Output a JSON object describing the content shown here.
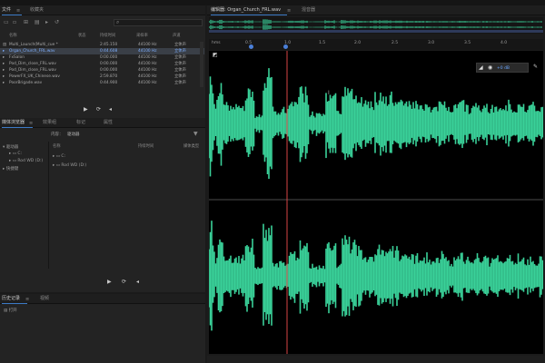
{
  "files_panel": {
    "tabs": [
      "文件",
      "收藏夹"
    ],
    "columns": [
      "名称",
      "状态",
      "持续时间",
      "采样率",
      "声道"
    ],
    "rows": [
      {
        "name": "Multi_Launch(Multi_cue *",
        "dur": "2:45.150",
        "rate": "44100 Hz",
        "ch": "立体声",
        "selected": false
      },
      {
        "name": "Organ_Church_FRL.wav",
        "dur": "0:44.608",
        "rate": "44100 Hz",
        "ch": "立体声",
        "selected": true
      },
      {
        "name": "FxSalon",
        "dur": "0:00.000",
        "rate": "44100 Hz",
        "ch": "立体声",
        "selected": false
      },
      {
        "name": "Pod_Dim_close_FRL.wav",
        "dur": "0:00.000",
        "rate": "44100 Hz",
        "ch": "立体声",
        "selected": false
      },
      {
        "name": "Pod_Dim_close_FRL.wav",
        "dur": "0:00.000",
        "rate": "44100 Hz",
        "ch": "立体声",
        "selected": false
      },
      {
        "name": "PowerFX_UK_Chinese.wav",
        "dur": "2:59.870",
        "rate": "44100 Hz",
        "ch": "立体声",
        "selected": false
      },
      {
        "name": "PoorBrigade.wav",
        "dur": "0:44.900",
        "rate": "44100 Hz",
        "ch": "立体声",
        "selected": false
      }
    ]
  },
  "media_panel": {
    "tabs": [
      "媒体浏览器",
      "效果组",
      "标记",
      "属性"
    ],
    "content_label": "内容：",
    "content_value": "驱动器",
    "tree_items": [
      "驱动器",
      "C:",
      "Rod WD (D:)",
      "快捷键"
    ],
    "columns": [
      "名称",
      "持续时间",
      "媒体类型"
    ],
    "list_items": [
      "C:",
      "Rod WD (D:)"
    ]
  },
  "history_panel": {
    "tabs": [
      "历史记录",
      "视频"
    ],
    "item": "打开"
  },
  "editor": {
    "tabs": [
      "编辑器: Organ_Church_FRL.wav",
      "混音器"
    ],
    "ruler_ticks": [
      "hms",
      "0.5",
      "1.0",
      "1.5",
      "2.0",
      "2.5",
      "3.0",
      "3.5",
      "4.0"
    ],
    "volume_value": "+0 dB"
  },
  "colors": {
    "waveform": "#3ad199",
    "playhead": "#d64545",
    "selection_tab_accent": "#3c7ac6"
  }
}
